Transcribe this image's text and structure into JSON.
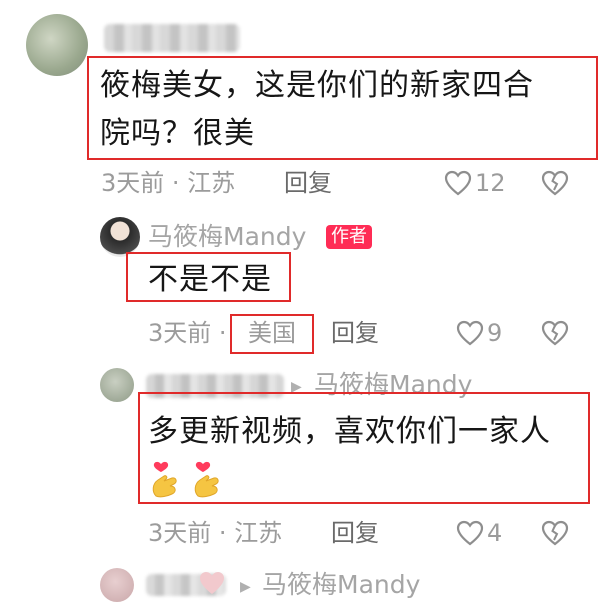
{
  "comments": [
    {
      "text": "筱梅美女，这是你们的新家四合院吗？很美",
      "text_line1": "筱梅美女，这是你们的新家四合",
      "text_line2": "院吗？很美",
      "time": "3天前",
      "location": "江苏",
      "reply_label": "回复",
      "likes": "12"
    }
  ],
  "author_reply": {
    "author_name": "马筱梅Mandy",
    "badge": "作者",
    "text": "不是不是",
    "time": "3天前",
    "location": "美国",
    "reply_label": "回复",
    "likes": "9"
  },
  "sub_reply_1": {
    "reply_to": "马筱梅Mandy",
    "text": "多更新视频，喜欢你们一家人",
    "time": "3天前",
    "location": "江苏",
    "reply_label": "回复",
    "likes": "4"
  },
  "sub_reply_2": {
    "reply_to": "马筱梅Mandy"
  },
  "separator": "·",
  "colors": {
    "highlight_box": "#e02a2a",
    "author_badge": "#ff2c55",
    "meta_text": "#9b9b9b"
  },
  "icons": [
    "heart-outline-icon",
    "dislike-broken-heart-icon",
    "heart-hands-emoji",
    "play-arrow-icon"
  ]
}
